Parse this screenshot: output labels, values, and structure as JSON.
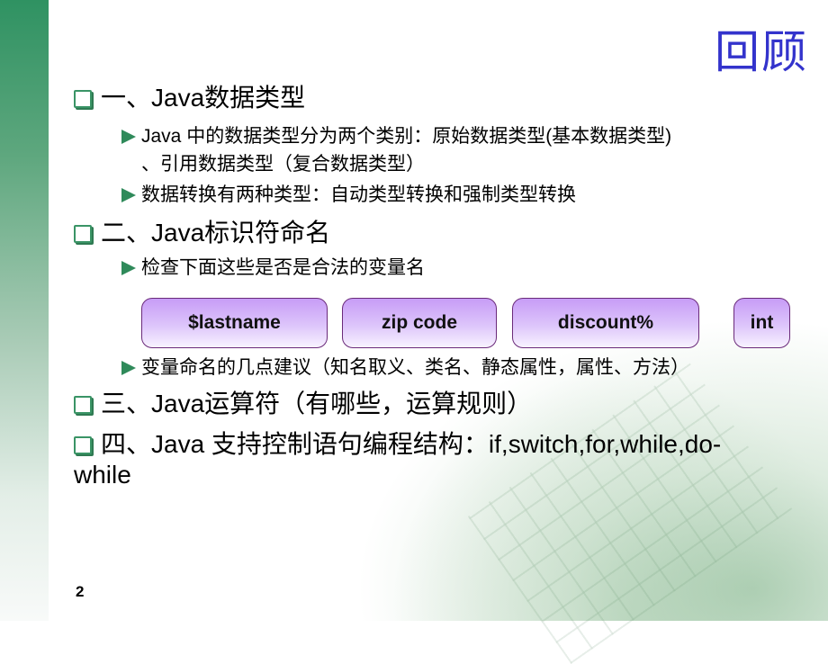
{
  "slide": {
    "title": "回顾",
    "page_number": "2",
    "accent_colors": {
      "title": "#3333cc",
      "sidebar": "#2f9262",
      "bullet": "#3a9466",
      "pill_border": "#6a2a7a"
    }
  },
  "sections": [
    {
      "heading": "一、Java数据类型",
      "bullet_icon": "checkbox-square-icon",
      "items": [
        {
          "line1": "Java 中的数据类型分为两个类别：原始数据类型(基本数据类型)",
          "line2": "、引用数据类型（复合数据类型）"
        },
        {
          "line1": "数据转换有两种类型：自动类型转换和强制类型转换"
        }
      ]
    },
    {
      "heading": "二、Java标识符命名",
      "items": [
        {
          "line1": "检查下面这些是否是合法的变量名"
        },
        {
          "line1": "变量命名的几点建议（知名取义、类名、静态属性，属性、方法）"
        }
      ],
      "variable_names": [
        "$lastname",
        "zip code",
        "discount%",
        "int"
      ]
    },
    {
      "heading": "三、Java运算符（有哪些，运算规则）"
    },
    {
      "heading_line1": "四、Java 支持控制语句编程结构：if,switch,for,while,do-",
      "heading_line2": "while"
    }
  ]
}
